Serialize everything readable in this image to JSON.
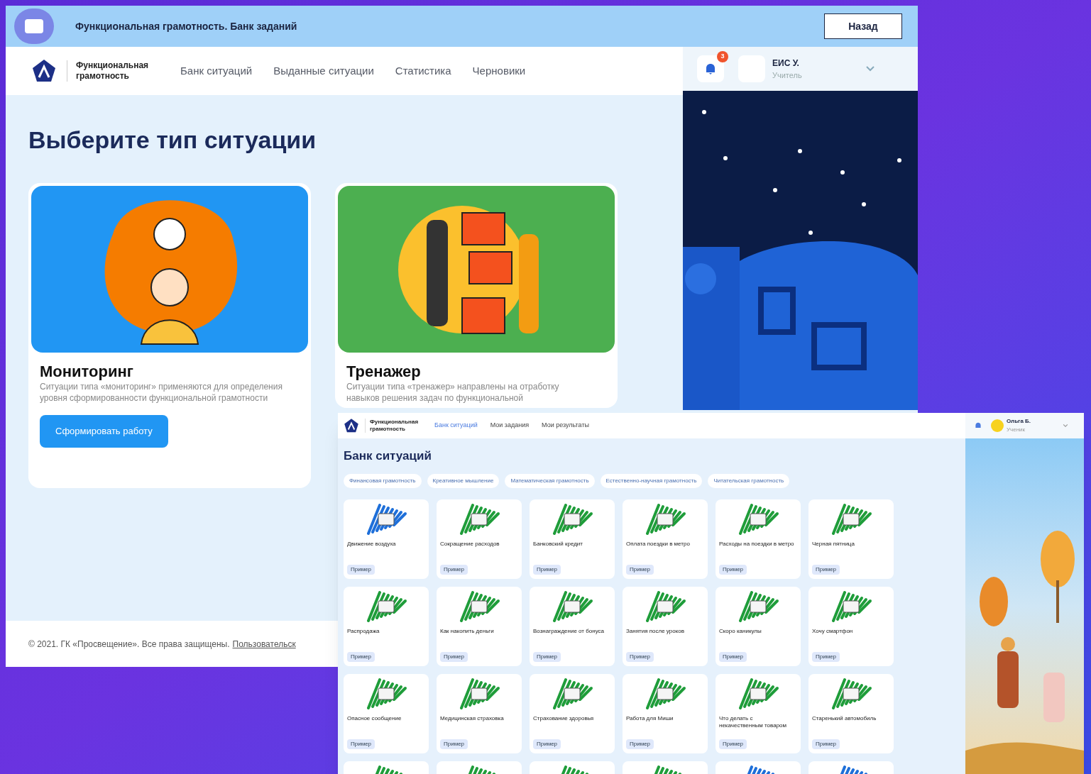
{
  "main_window": {
    "title": "Функциональная грамотность. Банк заданий",
    "back_button": "Назад",
    "brand": "Функциональная грамотность",
    "nav": [
      {
        "label": "Банк ситуаций",
        "selected": false
      },
      {
        "label": "Выданные ситуации",
        "selected": false
      },
      {
        "label": "Статистика",
        "selected": false
      },
      {
        "label": "Черновики",
        "selected": false
      }
    ],
    "notifications": {
      "count": "3"
    },
    "user": {
      "name": "ЕИС У.",
      "role": "Учитель"
    },
    "heading": "Выберите тип ситуации",
    "cards": [
      {
        "kind": "monitoring",
        "title": "Мониторинг",
        "description": "Ситуации типа «мониторинг» применяются для определения уровня сформированности функциональной грамотности",
        "button": "Сформировать работу"
      },
      {
        "kind": "trainer",
        "title": "Тренажер",
        "description": "Ситуации типа «тренажер» направлены на отработку навыков решения задач по функциональной"
      }
    ],
    "footer": {
      "copyright": "© 2021. ГК «Просвещение». Все права защищены.",
      "link": "Пользовательск"
    }
  },
  "bank_window": {
    "brand": "Функциональная грамотность",
    "nav": [
      {
        "label": "Банк ситуаций",
        "selected": true
      },
      {
        "label": "Мои задания",
        "selected": false
      },
      {
        "label": "Мои результаты",
        "selected": false
      }
    ],
    "user": {
      "name": "Ольга Б.",
      "role": "Ученик"
    },
    "heading": "Банк ситуаций",
    "filters": [
      "Финансовая грамотность",
      "Креативное мышление",
      "Математическая грамотность",
      "Естественно-научная грамотность",
      "Читательская грамотность"
    ],
    "situations": [
      {
        "title": "Движение воздуха",
        "tag": "Пример",
        "color": "#1e6fd9"
      },
      {
        "title": "Сокращение расходов",
        "tag": "Пример",
        "color": "#1f9d3a"
      },
      {
        "title": "Банковский кредит",
        "tag": "Пример",
        "color": "#1f9d3a"
      },
      {
        "title": "Оплата поездки в метро",
        "tag": "Пример",
        "color": "#1f9d3a"
      },
      {
        "title": "Расходы на поездки в метро",
        "tag": "Пример",
        "color": "#1f9d3a"
      },
      {
        "title": "Черная пятница",
        "tag": "Пример",
        "color": "#1f9d3a"
      },
      {
        "title": "Распродажа",
        "tag": "Пример",
        "color": "#1f9d3a"
      },
      {
        "title": "Как накопить деньги",
        "tag": "Пример",
        "color": "#1f9d3a"
      },
      {
        "title": "Вознаграждение от бонуса",
        "tag": "Пример",
        "color": "#1f9d3a"
      },
      {
        "title": "Занятия после уроков",
        "tag": "Пример",
        "color": "#1f9d3a"
      },
      {
        "title": "Скоро каникулы",
        "tag": "Пример",
        "color": "#1f9d3a"
      },
      {
        "title": "Хочу смартфон",
        "tag": "Пример",
        "color": "#1f9d3a"
      },
      {
        "title": "Опасное сообщение",
        "tag": "Пример",
        "color": "#1f9d3a"
      },
      {
        "title": "Медицинская страховка",
        "tag": "Пример",
        "color": "#1f9d3a"
      },
      {
        "title": "Страхование здоровья",
        "tag": "Пример",
        "color": "#1f9d3a"
      },
      {
        "title": "Работа для Миши",
        "tag": "Пример",
        "color": "#1f9d3a"
      },
      {
        "title": "Что делать с некачественным товаром",
        "tag": "Пример",
        "color": "#1f9d3a"
      },
      {
        "title": "Старенький автомобиль",
        "tag": "Пример",
        "color": "#1f9d3a"
      },
      {
        "color": "#1f9d3a"
      },
      {
        "color": "#1f9d3a"
      },
      {
        "color": "#1f9d3a"
      },
      {
        "color": "#1f9d3a"
      },
      {
        "color": "#1e6fd9"
      },
      {
        "color": "#1e6fd9"
      }
    ]
  }
}
